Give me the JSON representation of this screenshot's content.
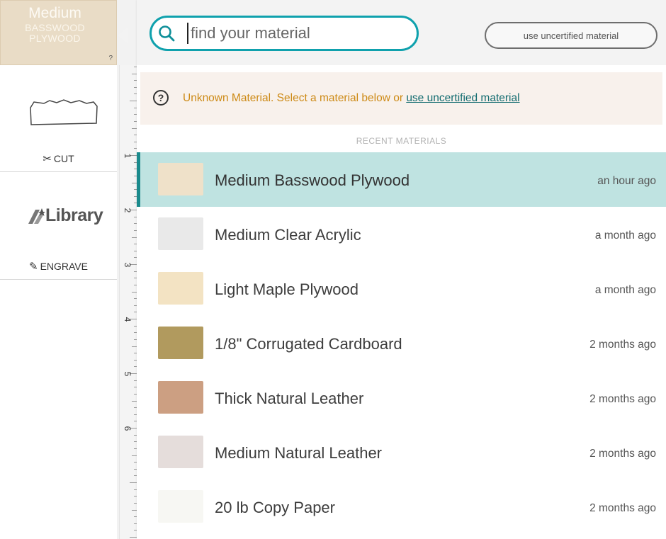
{
  "current_material": {
    "name": "Medium",
    "subtitle_line1": "BASSWOOD",
    "subtitle_line2": "PLYWOOD",
    "help": "?"
  },
  "sidebar": {
    "cut_label": "CUT",
    "library_logo_text": "Library",
    "engrave_label": "ENGRAVE"
  },
  "ruler": {
    "numbers": [
      "1",
      "2",
      "3",
      "4",
      "5",
      "6"
    ]
  },
  "search": {
    "placeholder": "find your material",
    "value": ""
  },
  "uncertified_button_label": "use uncertified material",
  "notice": {
    "icon": "?",
    "text": "Unknown Material. Select a material below or ",
    "link_text": "use uncertified material"
  },
  "recent_heading": "RECENT MATERIALS",
  "materials": [
    {
      "name": "Medium Basswood Plywood",
      "time": "an hour ago",
      "swatch_color": "#efe1c9",
      "selected": true
    },
    {
      "name": "Medium Clear Acrylic",
      "time": "a month ago",
      "swatch_color": "#e9e9e9",
      "selected": false
    },
    {
      "name": "Light Maple Plywood",
      "time": "a month ago",
      "swatch_color": "#f3e3c3",
      "selected": false
    },
    {
      "name": "1/8\" Corrugated Cardboard",
      "time": "2 months ago",
      "swatch_color": "#b19a5e",
      "selected": false
    },
    {
      "name": "Thick Natural Leather",
      "time": "2 months ago",
      "swatch_color": "#cc9f82",
      "selected": false
    },
    {
      "name": "Medium Natural Leather",
      "time": "2 months ago",
      "swatch_color": "#e5dddb",
      "selected": false
    },
    {
      "name": "20 lb Copy Paper",
      "time": "2 months ago",
      "swatch_color": "#f7f7f3",
      "selected": false
    }
  ],
  "colors": {
    "accent": "#0fa1ad",
    "selected_row": "#bfe3e1",
    "notice_text": "#cd8a16",
    "notice_link": "#136c70"
  }
}
